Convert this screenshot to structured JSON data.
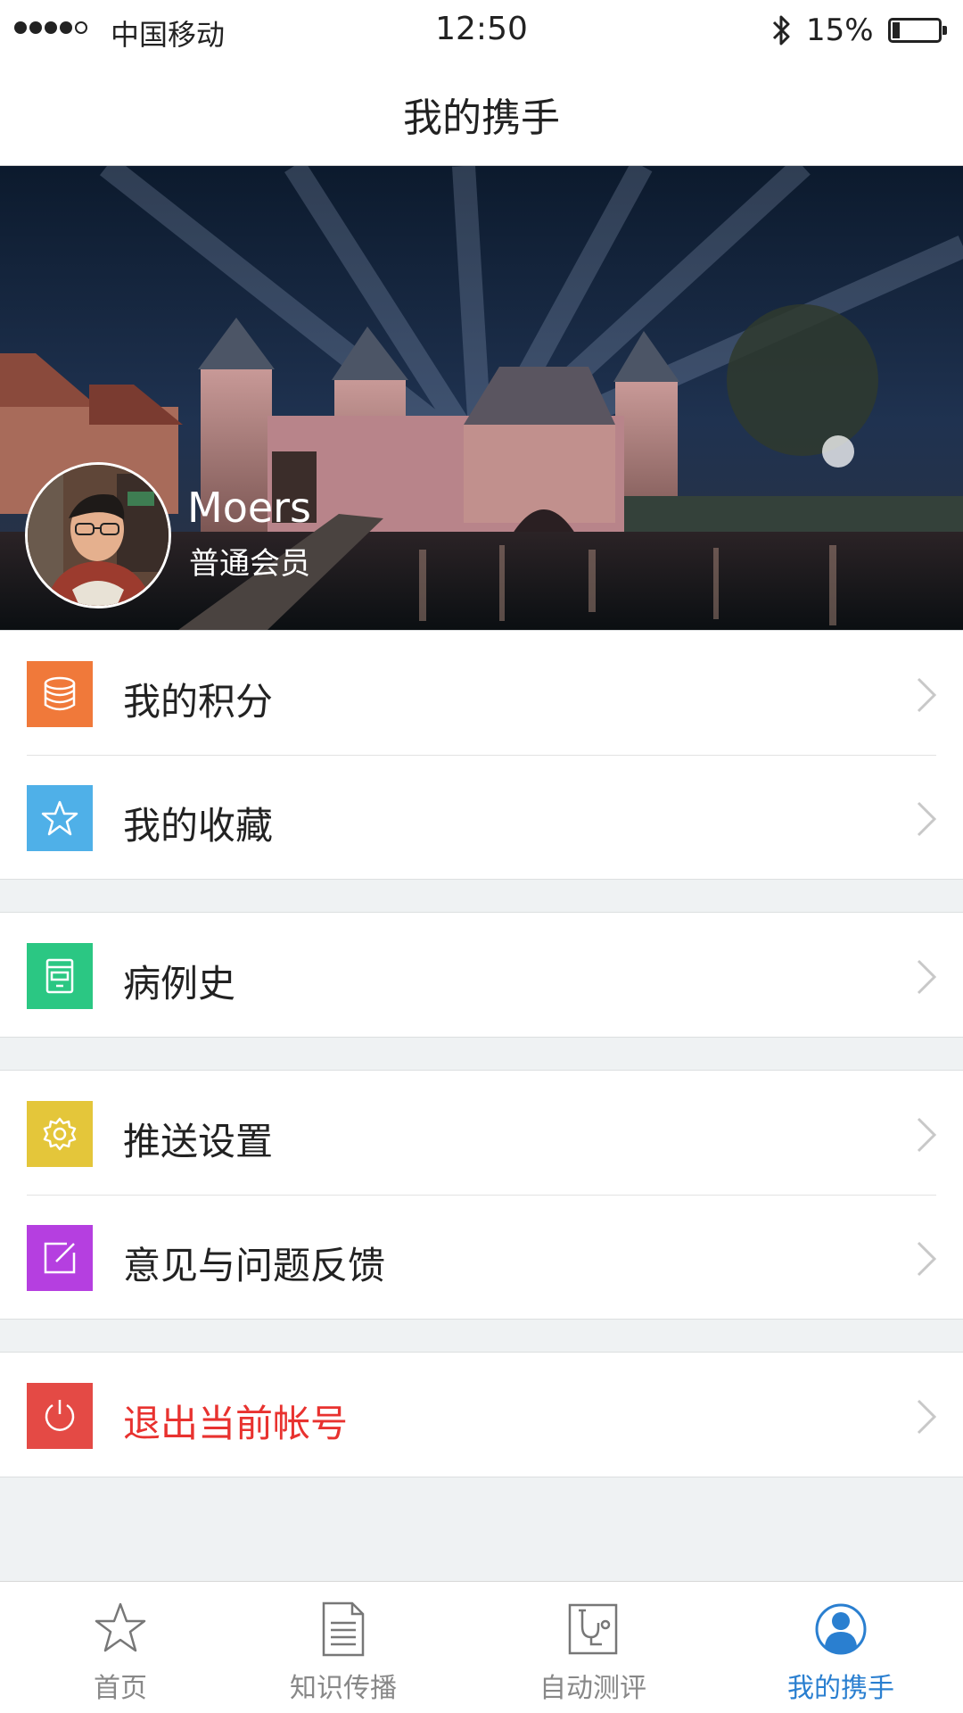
{
  "status_bar": {
    "carrier": "中国移动",
    "time": "12:50",
    "battery": "15%"
  },
  "nav": {
    "title": "我的携手"
  },
  "profile": {
    "name": "Moers",
    "level": "普通会员"
  },
  "menu": {
    "points": {
      "label": "我的积分",
      "icon": "database-icon",
      "color": "#f0793a"
    },
    "favorites": {
      "label": "我的收藏",
      "icon": "star-icon",
      "color": "#4fb0e8"
    },
    "history": {
      "label": "病例史",
      "icon": "folder-icon",
      "color": "#2bc783"
    },
    "push": {
      "label": "推送设置",
      "icon": "gear-icon",
      "color": "#e4c63a"
    },
    "feedback": {
      "label": "意见与问题反馈",
      "icon": "edit-icon",
      "color": "#b53fe0"
    },
    "logout": {
      "label": "退出当前帐号",
      "icon": "power-icon",
      "color": "#e44a45"
    }
  },
  "tabs": [
    {
      "label": "首页",
      "icon": "star-outline-icon",
      "active": false
    },
    {
      "label": "知识传播",
      "icon": "document-icon",
      "active": false
    },
    {
      "label": "自动测评",
      "icon": "stethoscope-icon",
      "active": false
    },
    {
      "label": "我的携手",
      "icon": "user-icon",
      "active": true
    }
  ],
  "colors": {
    "accent": "#2a7fd0",
    "danger": "#e8322f",
    "background": "#eff2f3"
  }
}
